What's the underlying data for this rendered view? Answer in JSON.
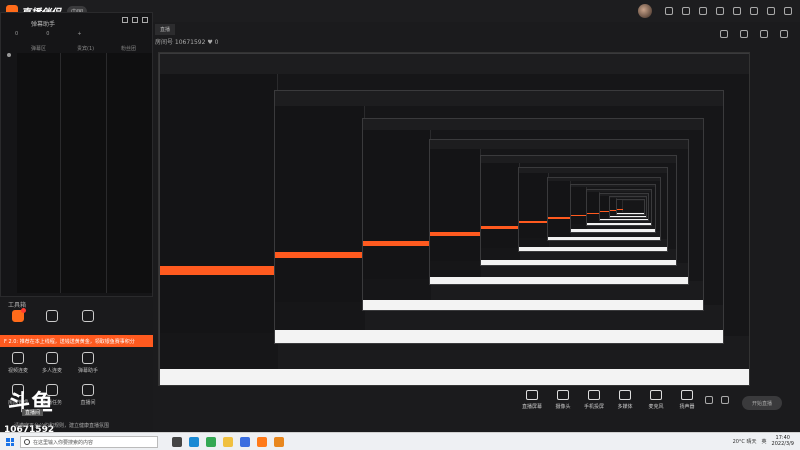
{
  "app": {
    "title": "直播伴侣",
    "version": "中国"
  },
  "left_panel": {
    "popup_title": "弹幕助手",
    "popup_tabs": [
      "0",
      "0",
      "+"
    ],
    "columns": [
      "弹幕区",
      "贵宾(1)",
      "粉丝团"
    ],
    "tool_section_label": "工具箱",
    "tools": [
      {
        "label": "",
        "icon": "gift-icon",
        "accent": true
      },
      {
        "label": "",
        "icon": "user-icon",
        "accent": false
      },
      {
        "label": "",
        "icon": "bag-icon",
        "accent": false
      },
      {
        "label": "视频连麦",
        "icon": "video-call-icon",
        "accent": false
      },
      {
        "label": "多人连麦",
        "icon": "multi-call-icon",
        "accent": false
      },
      {
        "label": "弹幕助手",
        "icon": "danmaku-helper-icon",
        "accent": false
      },
      {
        "label": "房间管理",
        "icon": "room-manage-icon",
        "accent": false
      },
      {
        "label": "主播任务",
        "icon": "task-icon",
        "accent": false
      },
      {
        "label": "直播间",
        "icon": "live-room-icon",
        "accent": false
      }
    ],
    "ticker": "F 2.0: 推荐在本上线程，送钱送黄黄金，领取银鱼赛事积分",
    "logo_text": "斗鱼",
    "logo_tag": "直播间",
    "room_number": "10671592"
  },
  "main_header": {
    "tab_label": "直播",
    "room_line": "房间号 10671592  ♥ 0"
  },
  "controls": {
    "items": [
      {
        "label": "直播屏幕",
        "icon": "screen-icon"
      },
      {
        "label": "摄像头",
        "icon": "camera-icon"
      },
      {
        "label": "手机投屏",
        "icon": "phone-cast-icon"
      },
      {
        "label": "多媒体",
        "icon": "media-icon"
      },
      {
        "label": "麦克风",
        "icon": "mic-icon"
      },
      {
        "label": "扬声器",
        "icon": "speaker-icon"
      }
    ],
    "start_label": "开始直播",
    "notice": "请遵守平台公约和规则，建立健康直播氛围"
  },
  "taskbar": {
    "search_placeholder": "在这里输入你要搜索的内容",
    "weather": "20°C 晴天",
    "ime": "英",
    "time": "17:40",
    "date": "2022/3/9",
    "apps": [
      {
        "icon": "task-view-icon",
        "color": "#444444"
      },
      {
        "icon": "edge-icon",
        "color": "#1a8ad4"
      },
      {
        "icon": "chrome-icon",
        "color": "#34a853"
      },
      {
        "icon": "explorer-icon",
        "color": "#f0c040"
      },
      {
        "icon": "store-icon",
        "color": "#3b6ee0"
      },
      {
        "icon": "app-orange-icon",
        "color": "#ff7a1a"
      },
      {
        "icon": "app-orange2-icon",
        "color": "#e8871e"
      }
    ]
  },
  "colors": {
    "accent": "#ff5a1f",
    "background": "#1b1b1d",
    "taskbar": "#eef0f3"
  }
}
